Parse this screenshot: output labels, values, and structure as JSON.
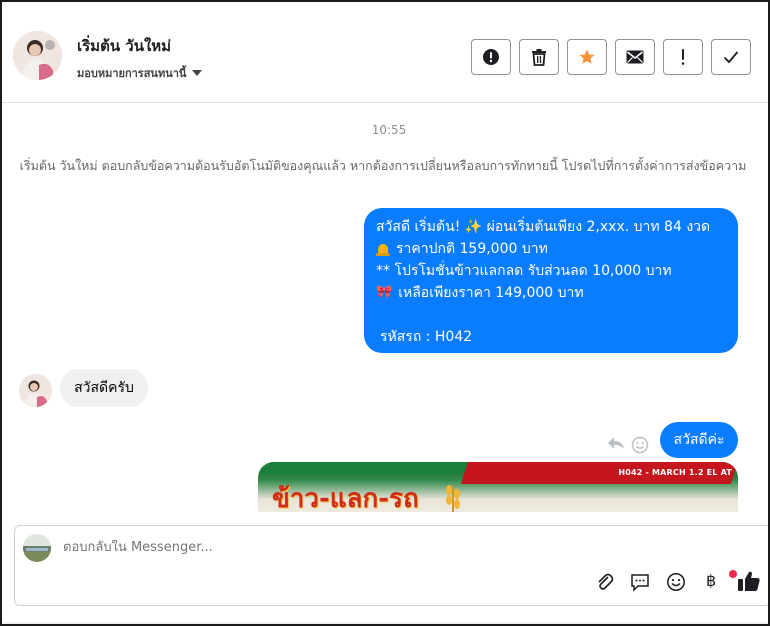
{
  "header": {
    "contact_name": "เริ่มต้น วันใหม่",
    "assign_label": "มอบหมายการสนทนานี้",
    "toolbar": [
      {
        "icon": "alert-circle-icon",
        "label": "Mark as spam"
      },
      {
        "icon": "trash-icon",
        "label": "Delete"
      },
      {
        "icon": "star-icon",
        "label": "Star",
        "color": "#f7923a"
      },
      {
        "icon": "envelope-icon",
        "label": "Mark as unread"
      },
      {
        "icon": "exclamation-icon",
        "label": "Follow up"
      },
      {
        "icon": "check-icon",
        "label": "Mark as done"
      }
    ]
  },
  "conversation": {
    "timestamp": "10:55",
    "auto_reply_notice": "เริ่มต้น วันใหม่ ตอบกลับข้อความต้อนรับอัตโนมัติของคุณแล้ว หากต้องการเปลี่ยนหรือลบการทักทายนี้ โปรดไปที่การตั้งค่าการส่งข้อความ",
    "welcome_message": {
      "line1": "สวัสดี เริ่มต้น! ✨  ผ่อนเริ่มต้นเพียง 2,xxx. บาท 84 งวด",
      "line2": "ราคาปกติ  159,000 บาท",
      "line3": "** โปรโมชั่นข้าวแลกลด รับส่วนลด 10,000 บาท",
      "line4": "เหลือเพียงราคา 149,000 บาท",
      "line5": "รหัสรถ : H042",
      "bubble_color": "#0a7cff"
    },
    "incoming_message": "สวัสดีครับ",
    "outgoing_reply": "สวัสดีค่ะ",
    "promo_image": {
      "title": "ข้าว-แลก-รถ",
      "code_text": "H042 - MARCH 1.2 EL AT"
    }
  },
  "composer": {
    "placeholder": "ตอบกลับใน Messenger...",
    "icons": [
      "paperclip-icon",
      "saved-reply-icon",
      "emoji-icon",
      "baht-payment-icon",
      "like-icon"
    ],
    "baht_symbol": "฿"
  }
}
